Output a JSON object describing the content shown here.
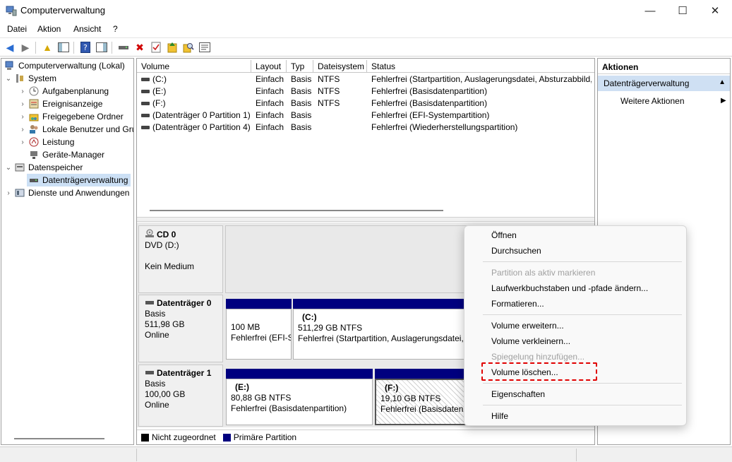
{
  "window": {
    "title": "Computerverwaltung",
    "minimize_glyph": "—",
    "maximize_glyph": "☐",
    "close_glyph": "✕"
  },
  "menubar": {
    "items": [
      "Datei",
      "Aktion",
      "Ansicht",
      "?"
    ]
  },
  "toolbar": {
    "icons": [
      "back-arrow-icon",
      "forward-arrow-icon",
      "up-folder-icon",
      "show-hide-tree-icon",
      "help-icon",
      "show-hide-action-pane-icon",
      "connect-drive-icon",
      "delete-icon",
      "check-icon",
      "export-icon",
      "search-icon",
      "properties-icon"
    ]
  },
  "tree": {
    "root": "Computerverwaltung (Lokal)",
    "system": "System",
    "aufgabenplanung": "Aufgabenplanung",
    "ereignisanzeige": "Ereignisanzeige",
    "freigegebene_ordner": "Freigegebene Ordner",
    "lokale_benutzer": "Lokale Benutzer und Gru",
    "leistung": "Leistung",
    "geraete_manager": "Geräte-Manager",
    "datenspeicher": "Datenspeicher",
    "datentraegerverwaltung": "Datenträgerverwaltung",
    "dienste": "Dienste und Anwendungen"
  },
  "volume_table": {
    "headers": {
      "volume": "Volume",
      "layout": "Layout",
      "typ": "Typ",
      "dateisystem": "Dateisystem",
      "status": "Status"
    },
    "rows": [
      {
        "volume": "(C:)",
        "layout": "Einfach",
        "typ": "Basis",
        "fs": "NTFS",
        "status": "Fehlerfrei (Startpartition, Auslagerungsdatei, Absturzabbild,"
      },
      {
        "volume": "(E:)",
        "layout": "Einfach",
        "typ": "Basis",
        "fs": "NTFS",
        "status": "Fehlerfrei (Basisdatenpartition)"
      },
      {
        "volume": "(F:)",
        "layout": "Einfach",
        "typ": "Basis",
        "fs": "NTFS",
        "status": "Fehlerfrei (Basisdatenpartition)"
      },
      {
        "volume": "(Datenträger 0 Partition 1)",
        "layout": "Einfach",
        "typ": "Basis",
        "fs": "",
        "status": "Fehlerfrei (EFI-Systempartition)"
      },
      {
        "volume": "(Datenträger 0 Partition 4)",
        "layout": "Einfach",
        "typ": "Basis",
        "fs": "",
        "status": "Fehlerfrei (Wiederherstellungspartition)"
      }
    ]
  },
  "disks": {
    "cd0": {
      "title": "CD 0",
      "line1": "DVD (D:)",
      "line2": "Kein Medium"
    },
    "disk0": {
      "title": "Datenträger 0",
      "type": "Basis",
      "size": "511,98 GB",
      "state": "Online",
      "p1": {
        "size": "100 MB",
        "status": "Fehlerfrei (EFI-S"
      },
      "p2": {
        "name": "(C:)",
        "size": "511,29 GB NTFS",
        "status": "Fehlerfrei (Startpartition, Auslagerungsdatei,"
      }
    },
    "disk1": {
      "title": "Datenträger 1",
      "type": "Basis",
      "size": "100,00 GB",
      "state": "Online",
      "p1": {
        "name": "(E:)",
        "size": "80,88 GB NTFS",
        "status": "Fehlerfrei (Basisdatenpartition)"
      },
      "p2": {
        "name": "(F:)",
        "size": "19,10 GB NTFS",
        "status": "Fehlerfrei (Basisdatenpartition"
      }
    }
  },
  "legend": {
    "unallocated": "Nicht zugeordnet",
    "primary": "Primäre Partition",
    "unallocated_color": "#000000",
    "primary_color": "#00007f"
  },
  "actions": {
    "header": "Aktionen",
    "selected": "Datenträgerverwaltung",
    "more": "Weitere Aktionen"
  },
  "context_menu": {
    "open": "Öffnen",
    "browse": "Durchsuchen",
    "mark_active": "Partition als aktiv markieren",
    "change_letter": "Laufwerkbuchstaben und -pfade ändern...",
    "format": "Formatieren...",
    "extend": "Volume erweitern...",
    "shrink": "Volume verkleinern...",
    "add_mirror": "Spiegelung hinzufügen...",
    "delete": "Volume löschen...",
    "properties": "Eigenschaften",
    "help": "Hilfe"
  },
  "colors": {
    "partition_bar": "#00007f",
    "selection": "#cfe0f3",
    "highlight_dashed": "#e00000"
  }
}
